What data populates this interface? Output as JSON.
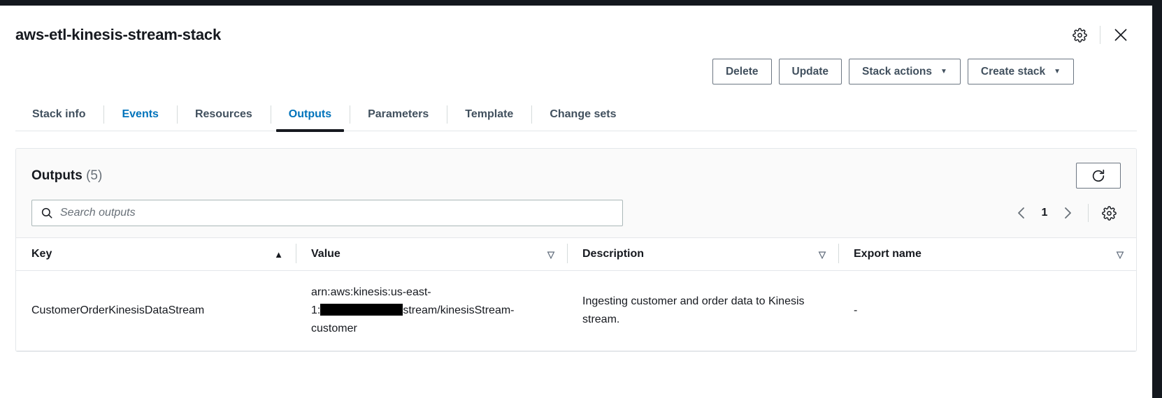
{
  "window": {
    "title": "aws-etl-kinesis-stream-stack",
    "settings_icon": "gear-icon",
    "close_icon": "close-icon"
  },
  "toolbar": {
    "buttons": [
      {
        "label": "Delete",
        "caret": ""
      },
      {
        "label": "Update",
        "caret": ""
      },
      {
        "label": "Stack actions",
        "caret": "▼"
      },
      {
        "label": "Create stack",
        "caret": "▼"
      }
    ]
  },
  "tabs": [
    {
      "label": "Stack info",
      "state": "normal"
    },
    {
      "label": "Events",
      "state": "link"
    },
    {
      "label": "Resources",
      "state": "normal"
    },
    {
      "label": "Outputs",
      "state": "active"
    },
    {
      "label": "Parameters",
      "state": "normal"
    },
    {
      "label": "Template",
      "state": "normal"
    },
    {
      "label": "Change sets",
      "state": "normal"
    }
  ],
  "card": {
    "title": "Outputs",
    "count": "(5)",
    "refresh_icon": "refresh-icon"
  },
  "search": {
    "placeholder": "Search outputs",
    "value": "",
    "icon": "search-icon"
  },
  "pagination": {
    "prev": "‹",
    "page": "1",
    "next": "›",
    "settings_icon": "gear-icon"
  },
  "table": {
    "columns": [
      {
        "label": "Key",
        "sort": "▲",
        "sort_state": "active"
      },
      {
        "label": "Value",
        "sort": "▽",
        "sort_state": "inactive"
      },
      {
        "label": "Description",
        "sort": "▽",
        "sort_state": "inactive"
      },
      {
        "label": "Export name",
        "sort": "▽",
        "sort_state": "inactive"
      }
    ],
    "rows": [
      {
        "key": "CustomerOrderKinesisDataStream",
        "value_line1": "arn:aws:kinesis:us-east-",
        "value_line2_prefix": "1:",
        "value_line2_suffix": "stream/kinesisStream-",
        "value_line3": "customer",
        "description": "Ingesting customer and order data to Kinesis stream.",
        "export_name": "-"
      }
    ]
  },
  "colors": {
    "link": "#0073bb",
    "active_tab_underline": "#16191f",
    "text": "#16191f",
    "muted": "#687078",
    "border": "#e4e7ea",
    "chrome": "#14181e"
  }
}
